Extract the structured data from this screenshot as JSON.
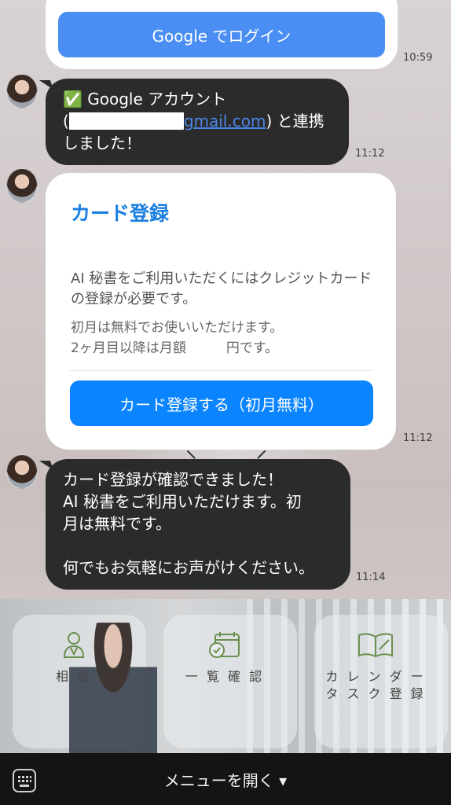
{
  "messages": [
    {
      "button_label": "Google でログイン",
      "time": "10:59"
    },
    {
      "check_icon": "✅",
      "line1": "Google アカウント",
      "line2_prefix": "(",
      "email_domain": "gmail.com",
      "line2_suffix": ") と連携",
      "line3": "しました！",
      "time": "11:12"
    },
    {
      "title": "カード登録",
      "body1": "AI 秘書をご利用いただくにはクレジットカードの登録が必要です。",
      "body2_line1": "初月は無料でお使いいただけます。",
      "body2_line2": "2ヶ月目以降は月額　　　円です。",
      "button_label": "カード登録する（初月無料）",
      "time": "11:12"
    },
    {
      "line1": "カード登録が確認できました！",
      "line2": "AI 秘書をご利用いただけます。初",
      "line3": "月は無料です。",
      "line4": "何でもお気軽にお声がけください。",
      "time": "11:14"
    }
  ],
  "rich_menu": {
    "items": [
      {
        "label": "相 談",
        "icon": "consultant-icon"
      },
      {
        "label": "一 覧 確 認",
        "icon": "calendar-check-icon"
      },
      {
        "label_line1": "カ レ ン ダ ー",
        "label_line2": "タ ス ク 登 録",
        "icon": "open-book-icon"
      }
    ]
  },
  "bottom_bar": {
    "menu_label": "メニューを開く ▾",
    "keyboard_icon": "keyboard-icon"
  },
  "colors": {
    "accent": "#0a84ff",
    "login_button": "#4a8ef3",
    "bubble_dark": "#2b2b2b",
    "bar": "#141414",
    "icon_green": "#6b8f4e"
  }
}
